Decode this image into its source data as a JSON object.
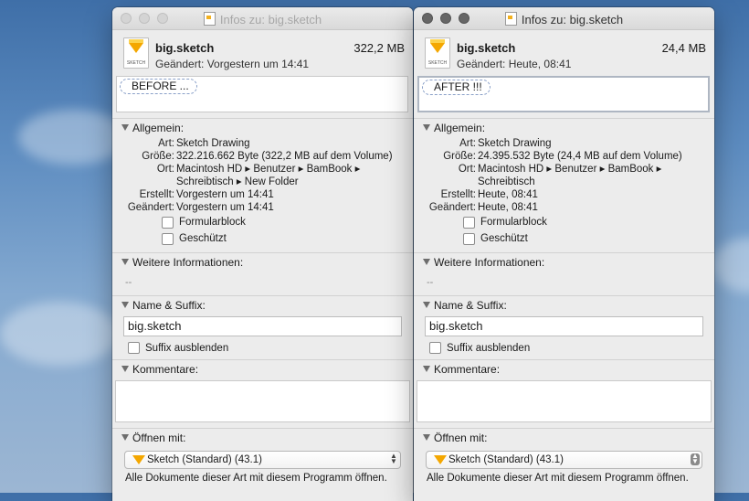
{
  "windows": [
    {
      "title": "Infos zu: big.sketch",
      "file": {
        "name": "big.sketch",
        "size": "322,2 MB",
        "modified": "Geändert: Vorgestern um 14:41",
        "icon_label": "SKETCH"
      },
      "tag": "BEFORE ...",
      "general": {
        "heading": "Allgemein:",
        "rows": [
          {
            "k": "Art:",
            "v": "Sketch Drawing"
          },
          {
            "k": "Größe:",
            "v": "322.216.662 Byte (322,2 MB auf dem Volume)"
          },
          {
            "k": "Ort:",
            "v": "Macintosh HD ▸ Benutzer ▸ BamBook ▸"
          },
          {
            "k": "",
            "v": "Schreibtisch ▸ New Folder"
          },
          {
            "k": "Erstellt:",
            "v": "Vorgestern um 14:41"
          },
          {
            "k": "Geändert:",
            "v": "Vorgestern um 14:41"
          }
        ],
        "checkbox_stationery": "Formularblock",
        "checkbox_locked": "Geschützt"
      },
      "more_info": {
        "heading": "Weitere Informationen:",
        "value": "--"
      },
      "name_ext": {
        "heading": "Name & Suffix:",
        "value": "big.sketch",
        "hide_ext": "Suffix ausblenden"
      },
      "comments": {
        "heading": "Kommentare:"
      },
      "open_with": {
        "heading": "Öffnen mit:",
        "app": "Sketch (Standard) (43.1)",
        "note": "Alle Dokumente dieser Art mit diesem Programm öffnen."
      }
    },
    {
      "title": "Infos zu: big.sketch",
      "file": {
        "name": "big.sketch",
        "size": "24,4 MB",
        "modified": "Geändert: Heute, 08:41",
        "icon_label": "SKETCH"
      },
      "tag": "AFTER !!!",
      "general": {
        "heading": "Allgemein:",
        "rows": [
          {
            "k": "Art:",
            "v": "Sketch Drawing"
          },
          {
            "k": "Größe:",
            "v": "24.395.532 Byte (24,4 MB auf dem Volume)"
          },
          {
            "k": "Ort:",
            "v": "Macintosh HD ▸ Benutzer ▸ BamBook ▸"
          },
          {
            "k": "",
            "v": "Schreibtisch"
          },
          {
            "k": "Erstellt:",
            "v": "Heute, 08:41"
          },
          {
            "k": "Geändert:",
            "v": "Heute, 08:41"
          }
        ],
        "checkbox_stationery": "Formularblock",
        "checkbox_locked": "Geschützt"
      },
      "more_info": {
        "heading": "Weitere Informationen:",
        "value": "--"
      },
      "name_ext": {
        "heading": "Name & Suffix:",
        "value": "big.sketch",
        "hide_ext": "Suffix ausblenden"
      },
      "comments": {
        "heading": "Kommentare:"
      },
      "open_with": {
        "heading": "Öffnen mit:",
        "app": "Sketch (Standard) (43.1)",
        "note": "Alle Dokumente dieser Art mit diesem Programm öffnen."
      }
    }
  ]
}
